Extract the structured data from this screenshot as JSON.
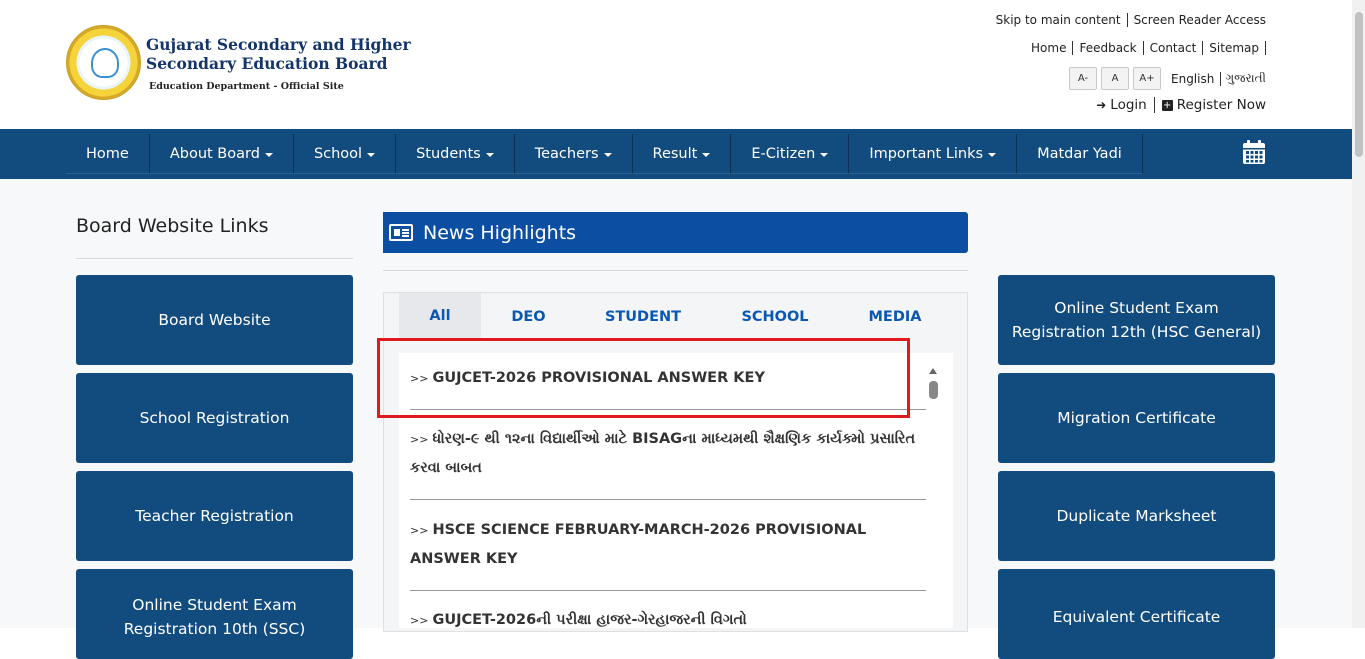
{
  "header": {
    "title_line1": "Gujarat Secondary and Higher",
    "title_line2": "Secondary Education Board",
    "subtitle": "Education Department - Official Site",
    "skip_link": "Skip to main content",
    "screen_reader": "Screen Reader Access",
    "links": [
      "Home",
      "Feedback",
      "Contact",
      "Sitemap"
    ],
    "font_small": "A-",
    "font_normal": "A",
    "font_large": "A+",
    "lang_en": "English",
    "lang_gu": "ગુજરાતી",
    "login": "Login",
    "register": "Register Now"
  },
  "nav": {
    "items": [
      "Home",
      "About Board",
      "School",
      "Students",
      "Teachers",
      "Result",
      "E-Citizen",
      "Important Links",
      "Matdar Yadi"
    ]
  },
  "left": {
    "title": "Board Website Links",
    "tiles": [
      "Board Website",
      "School Registration",
      "Teacher Registration",
      "Online Student Exam Registration 10th (SSC)"
    ]
  },
  "news": {
    "title": "News Highlights",
    "tabs": [
      "All",
      "DEO",
      "STUDENT",
      "SCHOOL",
      "MEDIA"
    ],
    "prefix": ">>",
    "items": [
      "GUJCET-2026 PROVISIONAL ANSWER KEY",
      "ધોરણ-૯ થી ૧૨ના વિદ્યાર્થીઓ માટે BISAGના માધ્યમથી શૈક્ષણિક કાર્યક્મો પ્રસારિત કરવા બાબત",
      "HSCE SCIENCE FEBRUARY-MARCH-2026 PROVISIONAL ANSWER KEY",
      "GUJCET-2026ની પરીક્ષા હાજર-ગેરહાજરની વિગતો"
    ]
  },
  "right": {
    "tiles": [
      "Online Student Exam Registration 12th (HSC General)",
      "Migration Certificate",
      "Duplicate Marksheet",
      "Equivalent Certificate"
    ]
  },
  "colors": {
    "nav_bg": "#124b7e",
    "news_head_bg": "#0b4ea2",
    "highlight": "#e0191f"
  }
}
